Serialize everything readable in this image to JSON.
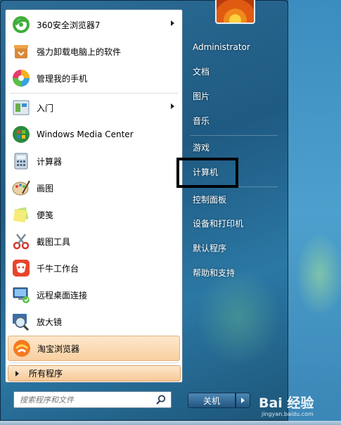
{
  "left_panel": {
    "programs": [
      {
        "label": "360安全浏览器7",
        "icon": "360-browser-icon",
        "has_arrow": true
      },
      {
        "label": "强力卸载电脑上的软件",
        "icon": "uninstall-icon",
        "has_arrow": false
      },
      {
        "label": "管理我的手机",
        "icon": "phone-manager-icon",
        "has_arrow": false
      },
      {
        "label": "入门",
        "icon": "getting-started-icon",
        "has_arrow": true
      },
      {
        "label": "Windows Media Center",
        "icon": "media-center-icon",
        "has_arrow": false
      },
      {
        "label": "计算器",
        "icon": "calculator-icon",
        "has_arrow": false
      },
      {
        "label": "画图",
        "icon": "paint-icon",
        "has_arrow": false
      },
      {
        "label": "便笺",
        "icon": "sticky-notes-icon",
        "has_arrow": false
      },
      {
        "label": "截图工具",
        "icon": "snipping-tool-icon",
        "has_arrow": false
      },
      {
        "label": "千牛工作台",
        "icon": "qianniu-icon",
        "has_arrow": false
      },
      {
        "label": "远程桌面连接",
        "icon": "remote-desktop-icon",
        "has_arrow": false
      },
      {
        "label": "放大镜",
        "icon": "magnifier-icon",
        "has_arrow": false
      },
      {
        "label": "淘宝浏览器",
        "icon": "taobao-browser-icon",
        "has_arrow": false
      }
    ],
    "all_programs_label": "所有程序",
    "search_placeholder": "搜索程序和文件"
  },
  "right_panel": {
    "items": [
      "Administrator",
      "文档",
      "图片",
      "音乐",
      "游戏",
      "计算机",
      "控制面板",
      "设备和打印机",
      "默认程序",
      "帮助和支持"
    ],
    "shutdown_label": "关机"
  },
  "watermark": {
    "brand": "Bai 经验",
    "sub": "jingyan.baidu.com"
  },
  "colors": {
    "highlight_border": "#000000",
    "hover_orange": "#f9cfa0",
    "panel_blue": "#1f5a82"
  }
}
